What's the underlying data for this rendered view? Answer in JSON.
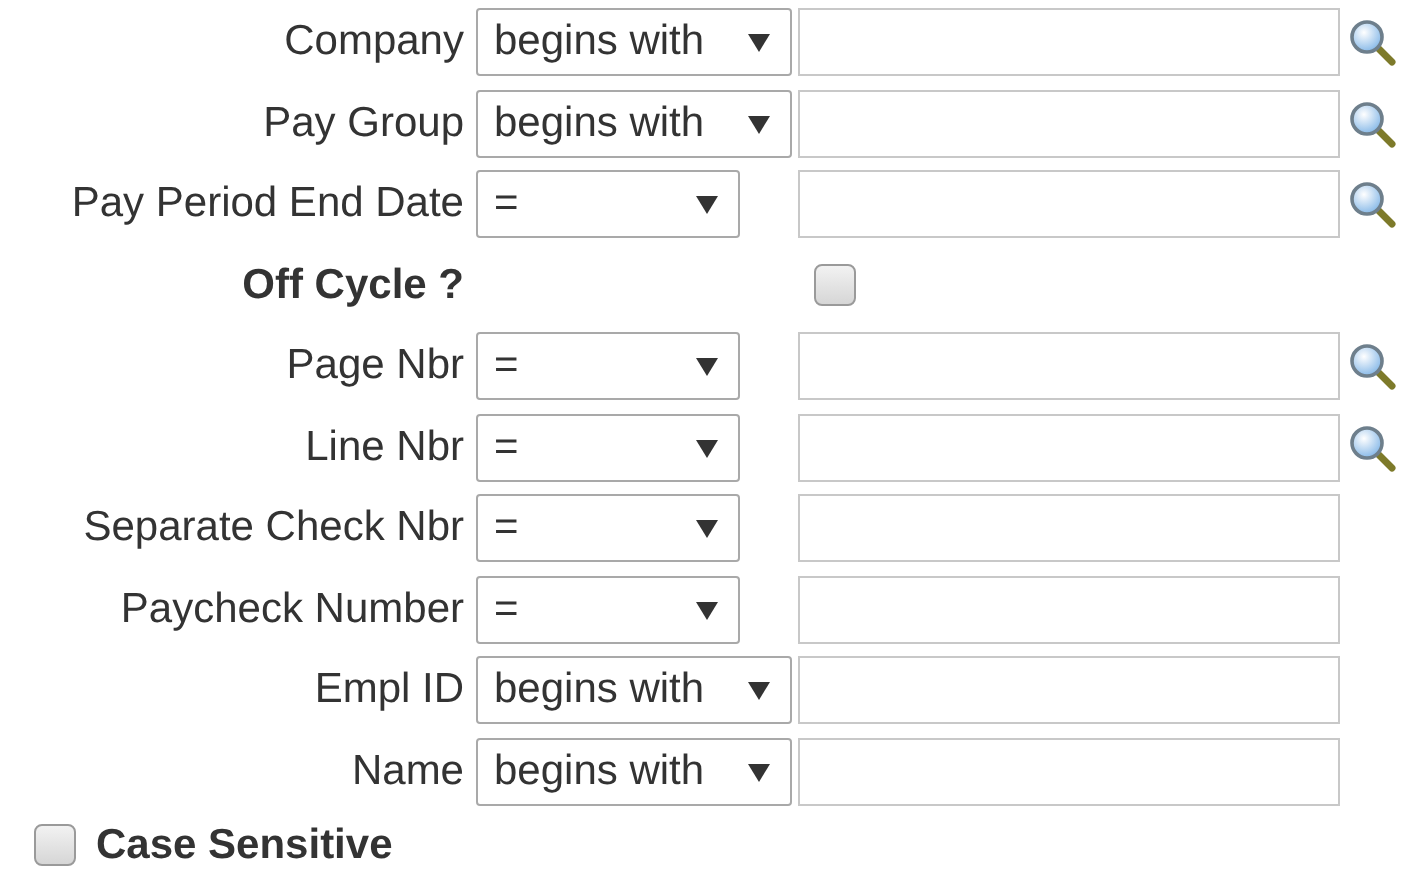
{
  "fields": [
    {
      "kind": "criteria",
      "label": "Company",
      "operator": "begins with",
      "lookup": true
    },
    {
      "kind": "criteria",
      "label": "Pay Group",
      "operator": "begins with",
      "lookup": true
    },
    {
      "kind": "criteria",
      "label": "Pay Period End Date",
      "operator": "=",
      "lookup": true
    },
    {
      "kind": "checkbox",
      "label": "Off Cycle ?",
      "checked": false
    },
    {
      "kind": "criteria",
      "label": "Page Nbr",
      "operator": "=",
      "lookup": true
    },
    {
      "kind": "criteria",
      "label": "Line Nbr",
      "operator": "=",
      "lookup": true
    },
    {
      "kind": "criteria",
      "label": "Separate Check Nbr",
      "operator": "=",
      "lookup": false
    },
    {
      "kind": "criteria",
      "label": "Paycheck Number",
      "operator": "=",
      "lookup": false
    },
    {
      "kind": "criteria",
      "label": "Empl ID",
      "operator": "begins with",
      "lookup": false
    },
    {
      "kind": "criteria",
      "label": "Name",
      "operator": "begins with",
      "lookup": false
    }
  ],
  "case_sensitive": {
    "label": "Case Sensitive",
    "checked": false
  }
}
